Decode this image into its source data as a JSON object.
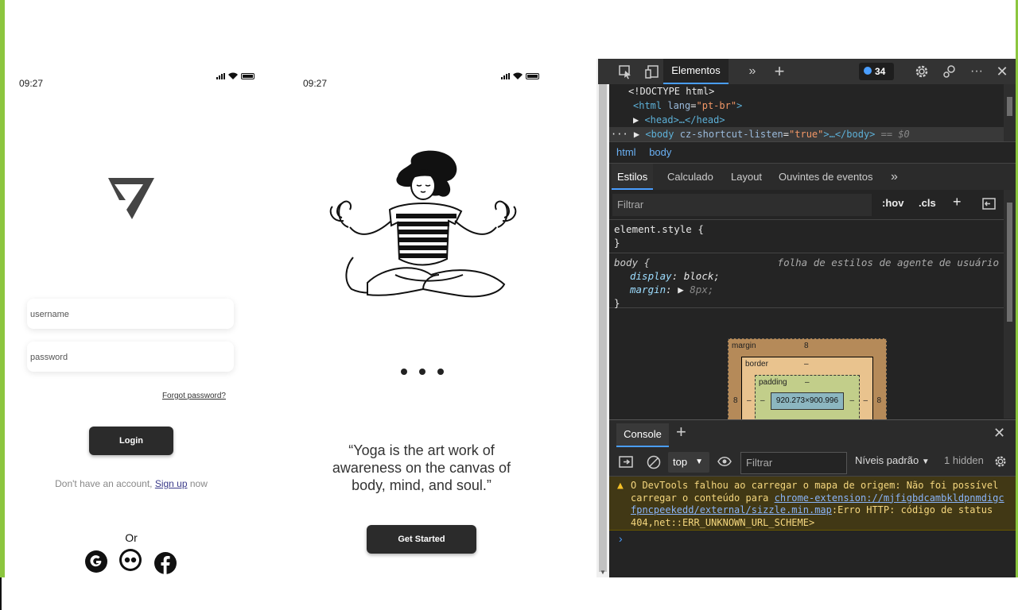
{
  "screen_login": {
    "time": "09:27",
    "username_placeholder": "username",
    "password_placeholder": "password",
    "forgot": "Forgot password?",
    "login": "Login",
    "no_account_pre": "Don't have an account, ",
    "signup": "Sign up",
    "no_account_post": " now",
    "or": "Or",
    "social_icons": [
      "google-icon",
      "flickr-icon",
      "facebook-icon"
    ]
  },
  "screen_onboarding": {
    "time": "09:27",
    "quote_line1": "“Yoga is the art work of",
    "quote_line2": "awareness on the canvas of",
    "quote_line3": "body, mind, and soul.”",
    "pager_dots": 3,
    "get_started": "Get Started"
  },
  "devtools": {
    "tab_elements": "Elementos",
    "issues_count": "34",
    "dom": {
      "doctype": "<!DOCTYPE html>",
      "html_open": "<html",
      "lang_attr": "lang",
      "lang_val": "\"pt-br\"",
      "html_close": ">",
      "head": "<head>…</head>",
      "body_open": "<body",
      "body_attr": "cz-shortcut-listen",
      "body_val": "\"true\"",
      "body_rest": ">…</body>",
      "eq": "== $0",
      "dots": "···"
    },
    "breadcrumbs": [
      "html",
      "body"
    ],
    "subtabs": [
      "Estilos",
      "Calculado",
      "Layout",
      "Ouvintes de eventos"
    ],
    "filter_placeholder": "Filtrar",
    "hov": ":hov",
    "cls": ".cls",
    "rule1_selector": "element.style {",
    "rule1_close": "}",
    "rule2_selector": "body {",
    "rule2_source": "folha de estilos de agente de usuário",
    "rule2_prop1": "display",
    "rule2_val1": "block;",
    "rule2_prop2": "margin",
    "rule2_val2": "8px;",
    "rule2_close": "}",
    "boxmodel": {
      "margin_label": "margin",
      "margin_val": "8",
      "border_label": "border",
      "border_val": "–",
      "padding_label": "padding",
      "padding_val": "–",
      "content": "920.273×900.996",
      "side_val": "8",
      "dash": "–"
    },
    "console_tab": "Console",
    "context": "top",
    "console_filter": "Filtrar",
    "levels": "Níveis padrão",
    "hidden": "1 hidden",
    "warning_pre": "O DevTools falhou ao carregar o mapa de origem: Não foi possível carregar o conteúdo para ",
    "warning_link": "chrome-extension://mjfigbdcambkldpnmdigcfpncpeekedd/external/sizzle.min.map",
    "warning_post": ":Erro HTTP: código de status 404,net::ERR_UNKNOWN_URL_SCHEME>",
    "prompt": "›"
  }
}
